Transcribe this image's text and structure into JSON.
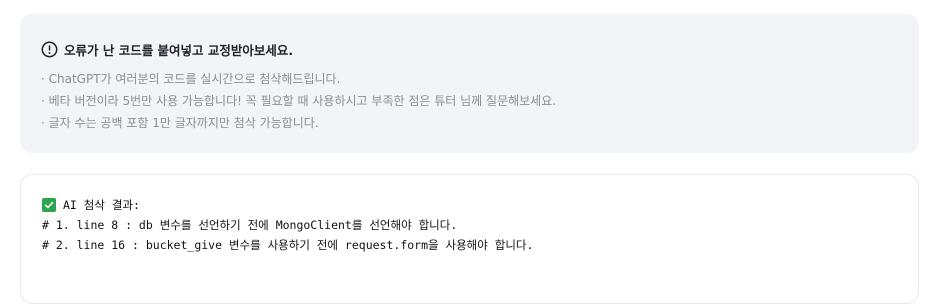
{
  "notice": {
    "icon": "info-icon",
    "title": "오류가 난 코드를 붙여넣고 교정받아보세요.",
    "lines": [
      "· ChatGPT가 여러분의 코드를 실시간으로 첨삭해드립니다.",
      "· 베타 버전이라 5번만 사용 가능합니다! 꼭 필요할 때 사용하시고 부족한 점은 튜터 님께 질문해보세요.",
      "· 글자 수는 공백 포함 1만 글자까지만 첨삭 가능합니다."
    ]
  },
  "result": {
    "icon": "check-icon",
    "title": "AI 첨삭 결과:",
    "lines": [
      "# 1. line 8 : db 변수를 선언하기 전에 MongoClient를 선언해야 합니다.",
      "# 2. line 16 : bucket_give 변수를 사용하기 전에 request.form을 사용해야 합니다."
    ]
  },
  "colors": {
    "notice_bg": "#f2f4f7",
    "check_green": "#2ea44f"
  }
}
